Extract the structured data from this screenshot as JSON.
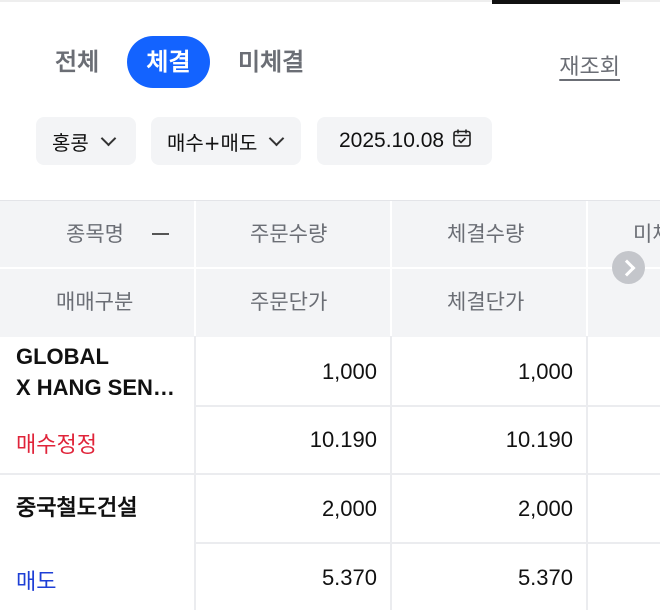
{
  "tabs": {
    "all": "전체",
    "filled": "체결",
    "unfilled": "미체결",
    "active": "filled"
  },
  "refresh_label": "재조회",
  "filters": {
    "market": "홍콩",
    "side": "매수+매도",
    "date": "2025.10.08"
  },
  "table": {
    "header_row1": {
      "name": "종목명",
      "order_qty": "주문수량",
      "filled_qty": "체결수량",
      "truncated": "미체"
    },
    "header_row2": {
      "trade_type": "매매구분",
      "order_price": "주문단가",
      "filled_price": "체결단가"
    },
    "rows": [
      {
        "name_line1": "GLOBAL",
        "name_line2": "X HANG SEN…",
        "trade_type": "매수정정",
        "order_qty": "1,000",
        "filled_qty": "1,000",
        "order_price": "10.190",
        "filled_price": "10.190"
      },
      {
        "name_line1": "중국철도건설",
        "trade_type": "매도",
        "order_qty": "2,000",
        "filled_qty": "2,000",
        "order_price": "5.370",
        "filled_price": "5.370"
      }
    ]
  },
  "colors": {
    "accent": "#1363ff",
    "buy": "#e0243a",
    "sell": "#1e3fd6"
  }
}
